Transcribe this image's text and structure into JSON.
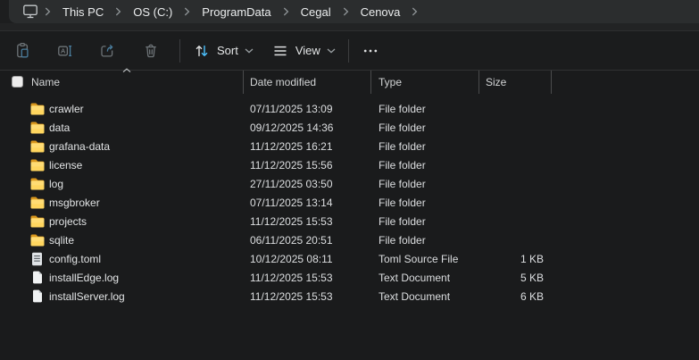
{
  "breadcrumb": {
    "root_icon": "monitor-icon",
    "items": [
      "This PC",
      "OS (C:)",
      "ProgramData",
      "Cegal",
      "Cenova"
    ]
  },
  "toolbar": {
    "icon_buttons": [
      "paste-icon",
      "rename-icon",
      "share-icon",
      "delete-icon"
    ],
    "sort_label": "Sort",
    "view_label": "View",
    "more_icon": "more-icon"
  },
  "table": {
    "columns": [
      "Name",
      "Date modified",
      "Type",
      "Size"
    ],
    "sort": {
      "column": "Name",
      "direction": "ascending"
    },
    "rows": [
      {
        "icon": "folder",
        "name": "crawler",
        "date": "07/11/2025 13:09",
        "type": "File folder",
        "size": ""
      },
      {
        "icon": "folder",
        "name": "data",
        "date": "09/12/2025 14:36",
        "type": "File folder",
        "size": ""
      },
      {
        "icon": "folder",
        "name": "grafana-data",
        "date": "11/12/2025 16:21",
        "type": "File folder",
        "size": ""
      },
      {
        "icon": "folder",
        "name": "license",
        "date": "11/12/2025 15:56",
        "type": "File folder",
        "size": ""
      },
      {
        "icon": "folder",
        "name": "log",
        "date": "27/11/2025 03:50",
        "type": "File folder",
        "size": ""
      },
      {
        "icon": "folder",
        "name": "msgbroker",
        "date": "07/11/2025 13:14",
        "type": "File folder",
        "size": ""
      },
      {
        "icon": "folder",
        "name": "projects",
        "date": "11/12/2025 15:53",
        "type": "File folder",
        "size": ""
      },
      {
        "icon": "folder",
        "name": "sqlite",
        "date": "06/11/2025 20:51",
        "type": "File folder",
        "size": ""
      },
      {
        "icon": "text-file",
        "name": "config.toml",
        "date": "10/12/2025 08:11",
        "type": "Toml Source File",
        "size": "1 KB"
      },
      {
        "icon": "file",
        "name": "installEdge.log",
        "date": "11/12/2025 15:53",
        "type": "Text Document",
        "size": "5 KB"
      },
      {
        "icon": "file",
        "name": "installServer.log",
        "date": "11/12/2025 15:53",
        "type": "Text Document",
        "size": "6 KB"
      }
    ]
  },
  "colors": {
    "accent_blue": "#4cc2ff",
    "folder_yellow": "#ffd65f",
    "background": "#1a1b1c",
    "address_bar": "#2b2d2e"
  }
}
